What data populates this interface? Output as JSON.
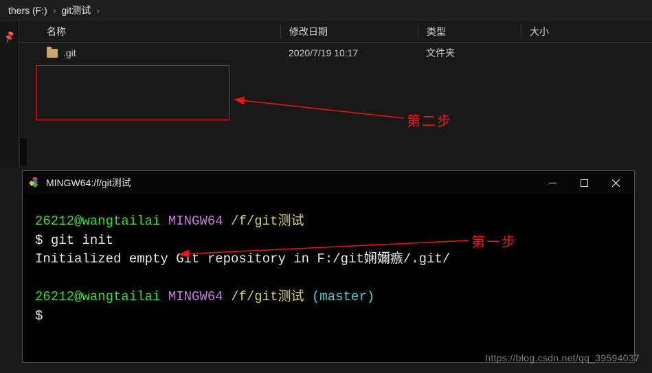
{
  "breadcrumb": {
    "item0": "thers (F:)",
    "item1": "git测试"
  },
  "explorer": {
    "headers": {
      "name": "名称",
      "date": "修改日期",
      "type": "类型",
      "size": "大小"
    },
    "rows": [
      {
        "name": ".git",
        "date": "2020/7/19 10:17",
        "type": "文件夹",
        "size": ""
      }
    ]
  },
  "annotations": {
    "step1": "第一步",
    "step2": "第二步"
  },
  "terminal": {
    "title": "MINGW64:/f/git测试",
    "line1": {
      "user": "26212@wangtailai",
      "host": "MINGW64",
      "path": "/f/git测试"
    },
    "cmd": {
      "prompt": "$ ",
      "text": "git init"
    },
    "output": "Initialized empty Git repository in F:/git娴嬭瘯/.git/",
    "line2": {
      "user": "26212@wangtailai",
      "host": "MINGW64",
      "path": "/f/git测试",
      "branch": "(master)"
    },
    "prompt2": "$"
  },
  "watermark": "https://blog.csdn.net/qq_39594037"
}
